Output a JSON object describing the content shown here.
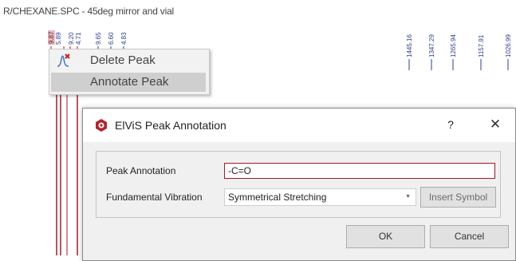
{
  "spectrum": {
    "title": "R/CHEXANE.SPC - 45deg mirror and vial",
    "left_peak_labels": [
      "9.87",
      "5.89",
      "9.20",
      "4.71",
      "9.65",
      "6.60",
      "4.83"
    ],
    "right_peak_labels": [
      "1445.16",
      "1347.29",
      "1265.94",
      "1157.91",
      "1026.99"
    ],
    "selected_peak_color": "#f4b4be",
    "peak_line_color": "#a11d2b",
    "label_color": "#2a3f8f"
  },
  "context_menu": {
    "items": [
      {
        "label": "Delete Peak",
        "icon": "delete-peak-icon"
      },
      {
        "label": "Annotate Peak",
        "icon": ""
      }
    ]
  },
  "dialog": {
    "title": "ElViS Peak Annotation",
    "app_icon": "elvis-logo-icon",
    "help": "?",
    "close": "✕",
    "peak_annotation_label": "Peak Annotation",
    "peak_annotation_value": "-C=O",
    "fundamental_vibration_label": "Fundamental Vibration",
    "fundamental_vibration_value": "Symmetrical Stretching",
    "insert_symbol_label": "Insert Symbol",
    "ok_label": "OK",
    "cancel_label": "Cancel",
    "accent_color": "#a01a2a"
  }
}
